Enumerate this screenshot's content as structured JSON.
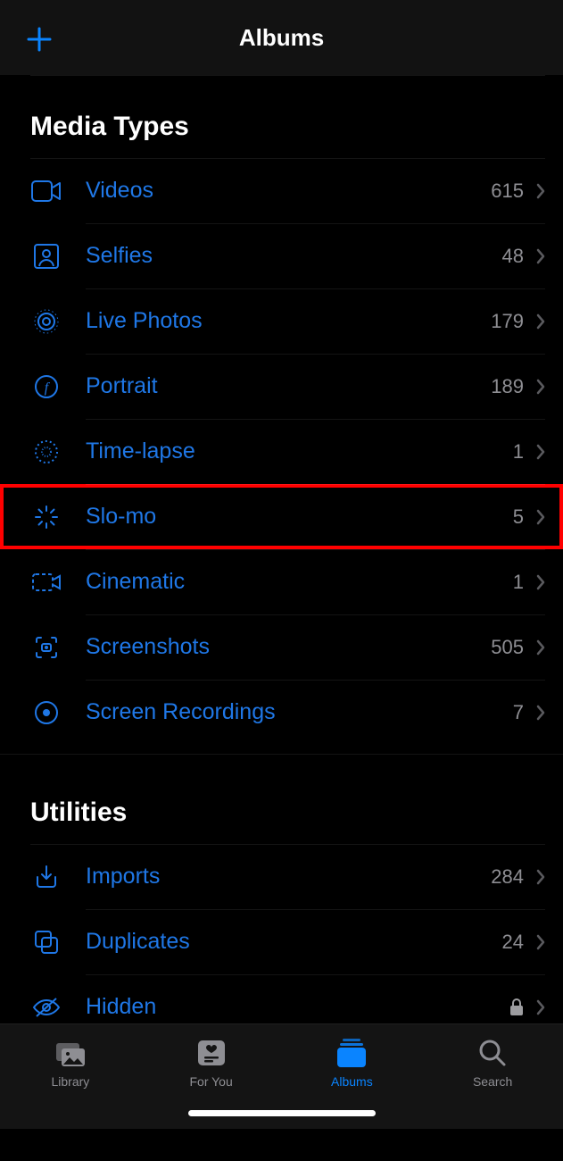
{
  "nav": {
    "title": "Albums"
  },
  "sections": {
    "media_types": {
      "title": "Media Types",
      "items": [
        {
          "icon": "videos-icon",
          "label": "Videos",
          "count": "615"
        },
        {
          "icon": "selfies-icon",
          "label": "Selfies",
          "count": "48"
        },
        {
          "icon": "live-photos-icon",
          "label": "Live Photos",
          "count": "179"
        },
        {
          "icon": "portrait-icon",
          "label": "Portrait",
          "count": "189"
        },
        {
          "icon": "timelapse-icon",
          "label": "Time-lapse",
          "count": "1"
        },
        {
          "icon": "slo-mo-icon",
          "label": "Slo-mo",
          "count": "5",
          "highlighted": true
        },
        {
          "icon": "cinematic-icon",
          "label": "Cinematic",
          "count": "1"
        },
        {
          "icon": "screenshots-icon",
          "label": "Screenshots",
          "count": "505"
        },
        {
          "icon": "screen-rec-icon",
          "label": "Screen Recordings",
          "count": "7"
        }
      ]
    },
    "utilities": {
      "title": "Utilities",
      "items": [
        {
          "icon": "imports-icon",
          "label": "Imports",
          "count": "284"
        },
        {
          "icon": "duplicates-icon",
          "label": "Duplicates",
          "count": "24"
        },
        {
          "icon": "hidden-icon",
          "label": "Hidden",
          "locked": true
        }
      ]
    }
  },
  "tabs": [
    {
      "icon": "library-tab-icon",
      "label": "Library"
    },
    {
      "icon": "for-you-tab-icon",
      "label": "For You"
    },
    {
      "icon": "albums-tab-icon",
      "label": "Albums",
      "active": true
    },
    {
      "icon": "search-tab-icon",
      "label": "Search"
    }
  ]
}
